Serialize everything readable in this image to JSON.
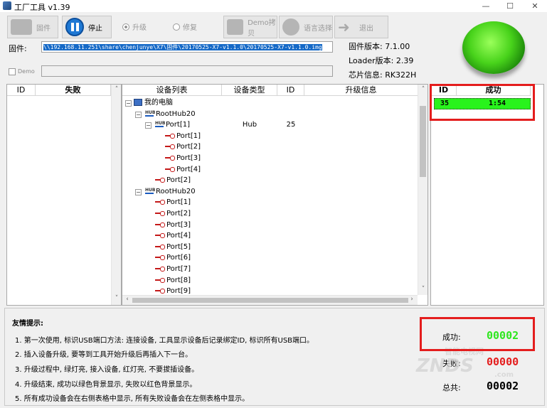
{
  "window": {
    "title": "工厂工具 v1.39",
    "minimize": "—",
    "maximize": "☐",
    "close": "✕"
  },
  "toolbar": {
    "firmware_label": "固件",
    "stop_label": "停止",
    "upgrade_label": "升级",
    "repair_label": "修复",
    "demo_copy_label": "Demo拷贝",
    "language_label": "语言选择",
    "exit_label": "退出"
  },
  "info": {
    "firmware_field_label": "固件:",
    "firmware_path": "\\\\192.168.11.251\\share\\chenjunye\\X7\\固件\\20170525-X7-v1.1.0\\20170525-X7-v1.1.0.img",
    "demo_label": "Demo",
    "firmware_version": "固件版本: 7.1.00",
    "loader_version": "Loader版本: 2.39",
    "chip_info": "芯片信息: RK322H"
  },
  "fail_table": {
    "col_id": "ID",
    "col_fail": "失败"
  },
  "device_tree": {
    "headers": [
      "设备列表",
      "设备类型",
      "ID",
      "升级信息"
    ],
    "rows": [
      {
        "label": "我的电脑",
        "kind": "pc",
        "type": "",
        "id": ""
      },
      {
        "label": "RootHub20",
        "kind": "hub",
        "type": "",
        "id": ""
      },
      {
        "label": "Port[1]",
        "kind": "hub",
        "type": "Hub",
        "id": "25"
      },
      {
        "label": "Port[1]",
        "kind": "port",
        "type": "",
        "id": ""
      },
      {
        "label": "Port[2]",
        "kind": "port",
        "type": "",
        "id": ""
      },
      {
        "label": "Port[3]",
        "kind": "port",
        "type": "",
        "id": ""
      },
      {
        "label": "Port[4]",
        "kind": "port",
        "type": "",
        "id": ""
      },
      {
        "label": "Port[2]",
        "kind": "port",
        "type": "",
        "id": ""
      },
      {
        "label": "RootHub20",
        "kind": "hub",
        "type": "",
        "id": ""
      },
      {
        "label": "Port[1]",
        "kind": "port",
        "type": "",
        "id": ""
      },
      {
        "label": "Port[2]",
        "kind": "port",
        "type": "",
        "id": ""
      },
      {
        "label": "Port[3]",
        "kind": "port",
        "type": "",
        "id": ""
      },
      {
        "label": "Port[4]",
        "kind": "port",
        "type": "",
        "id": ""
      },
      {
        "label": "Port[5]",
        "kind": "port",
        "type": "",
        "id": ""
      },
      {
        "label": "Port[6]",
        "kind": "port",
        "type": "",
        "id": ""
      },
      {
        "label": "Port[7]",
        "kind": "port",
        "type": "",
        "id": ""
      },
      {
        "label": "Port[8]",
        "kind": "port",
        "type": "",
        "id": ""
      },
      {
        "label": "Port[9]",
        "kind": "port",
        "type": "",
        "id": ""
      }
    ]
  },
  "success_table": {
    "col_id": "ID",
    "col_success": "成功",
    "rows": [
      {
        "id": "35",
        "value": "1:54"
      }
    ]
  },
  "tips": {
    "title": "友情提示:",
    "items": [
      "1. 第一次使用, 标识USB端口方法: 连接设备, 工具显示设备后记录绑定ID, 标识所有USB端口。",
      "2. 插入设备升级, 要等到工具开始升级后再插入下一台。",
      "3. 升级过程中, 绿灯亮, 接入设备, 红灯亮, 不要拔插设备。",
      "4. 升级结束, 成功以绿色背景显示, 失败以红色背景显示。",
      "5. 所有成功设备会在右侧表格中显示, 所有失败设备会在左侧表格中显示。"
    ]
  },
  "stats": {
    "success_label": "成功:",
    "success_value": "00002",
    "fail_label": "失败:",
    "fail_value": "00000",
    "total_label": "总共:",
    "total_value": "00002"
  },
  "watermark": {
    "top": "智能电视网",
    "main": "ZNDS",
    "sub": ".com"
  },
  "colors": {
    "success_green": "#28f31c",
    "highlight_red": "#e41d1d",
    "selection_blue": "#1569c7"
  }
}
